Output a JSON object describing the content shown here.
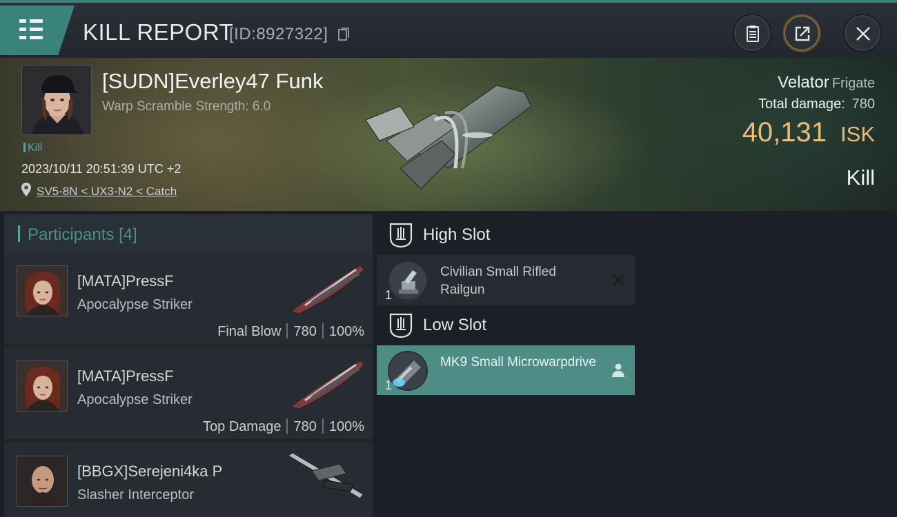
{
  "header": {
    "title": "KILL REPORT",
    "report_id": "[ID:8927322]",
    "buttons": [
      "clipboard",
      "share",
      "close"
    ]
  },
  "victim": {
    "name": "[SUDN]Everley47 Funk",
    "warp_scramble": "Warp Scramble Strength: 6.0",
    "tag": "Kill",
    "datetime": "2023/10/11 20:51:39 UTC +2",
    "location": "SV5-8N < UX3-N2 < Catch",
    "ship": "Velator",
    "ship_class": "Frigate",
    "total_damage_label": "Total damage:",
    "total_damage": "780",
    "isk_value": "40,131",
    "isk_unit": "ISK",
    "result": "Kill"
  },
  "participants": {
    "title": "Participants",
    "count": "[4]",
    "rows": [
      {
        "name": "[MATA]PressF",
        "ship": "Apocalypse Striker",
        "role": "Final Blow",
        "damage": "780",
        "percent": "100%"
      },
      {
        "name": "[MATA]PressF",
        "ship": "Apocalypse Striker",
        "role": "Top Damage",
        "damage": "780",
        "percent": "100%"
      },
      {
        "name": "[BBGX]Serejeni4ka P",
        "ship": "Slasher Interceptor",
        "role": "",
        "damage": "",
        "percent": ""
      }
    ]
  },
  "fitting": {
    "high_slot": {
      "title": "High Slot",
      "modules": [
        {
          "name": "Civilian Small Rifled Railgun",
          "qty": "1",
          "icon": "railgun-icon",
          "action": "x"
        }
      ]
    },
    "low_slot": {
      "title": "Low Slot",
      "modules": [
        {
          "name": "MK9 Small Microwarpdrive",
          "qty": "1",
          "icon": "microwarpdrive-icon",
          "action": "person"
        }
      ]
    }
  },
  "colors": {
    "accent": "#3a837d",
    "isk": "#e6c07a",
    "active_module": "#4e8d86"
  }
}
